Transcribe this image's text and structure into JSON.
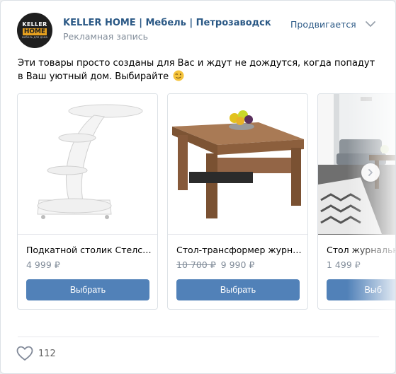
{
  "header": {
    "avatar": {
      "line1": "KELLER",
      "line2": "HOME",
      "line3": "мебель для дома"
    },
    "group_name": "KELLER HOME | Мебель | Петрозаводск",
    "ad_label": "Рекламная запись",
    "promoted_label": "Продвигается"
  },
  "post": {
    "text": "Эти товары просто созданы для Вас и ждут не дождутся, когда попадут в Ваш уютный дом. Выбирайте",
    "emoji": "wink-emoji-icon"
  },
  "carousel": {
    "cards": [
      {
        "title": "Подкатной столик Стелс (...",
        "old_price": "",
        "price": "4 999 ₽",
        "button": "Выбрать"
      },
      {
        "title": "Стол-трансформер журна...",
        "old_price": "10 700 ₽",
        "price": "9 990 ₽",
        "button": "Выбрать"
      },
      {
        "title": "Стол журнальн",
        "old_price": "",
        "price": "1 499 ₽",
        "button": "Выб"
      }
    ],
    "next_icon": "chevron-right-icon"
  },
  "footer": {
    "likes": "112",
    "like_icon": "heart-icon"
  },
  "colors": {
    "link": "#2a5885",
    "button": "#5181b8",
    "secondary_text": "#818c99",
    "brand_orange": "#e8a21f"
  }
}
